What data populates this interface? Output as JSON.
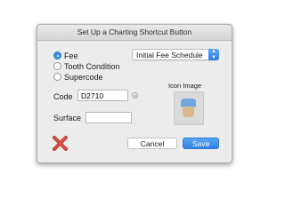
{
  "dialog": {
    "title": "Set Up a Charting Shortcut Button",
    "options": [
      {
        "label": "Fee",
        "selected": true
      },
      {
        "label": "Tooth Condition",
        "selected": false
      },
      {
        "label": "Supercode",
        "selected": false
      }
    ],
    "fee_schedule": {
      "value": "Initial Fee Schedule",
      "icon": "chevron-updown-icon"
    },
    "code": {
      "label": "Code",
      "value": "D2710"
    },
    "surface": {
      "label": "Surface",
      "value": ""
    },
    "icon_image": {
      "label": "Icon Image",
      "icon": "tooth-icon"
    },
    "delete_icon": "red-x-icon",
    "cancel_label": "Cancel",
    "save_label": "Save",
    "colors": {
      "accent": "#3a8ee6",
      "delete": "#c0392b"
    }
  }
}
